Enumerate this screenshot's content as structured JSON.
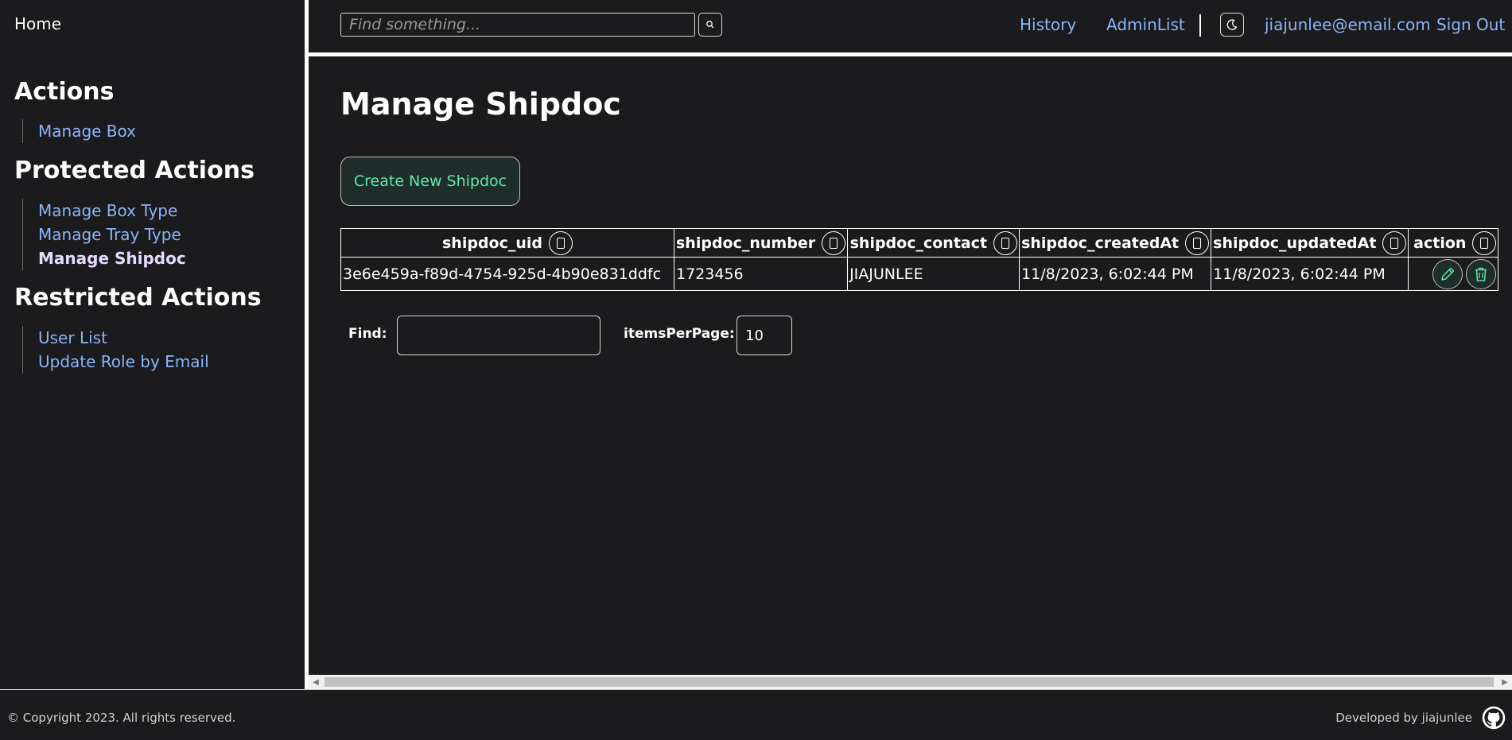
{
  "sidebar": {
    "home": "Home",
    "sections": [
      {
        "title": "Actions",
        "items": [
          {
            "label": "Manage Box",
            "active": false
          }
        ]
      },
      {
        "title": "Protected Actions",
        "items": [
          {
            "label": "Manage Box Type",
            "active": false
          },
          {
            "label": "Manage Tray Type",
            "active": false
          },
          {
            "label": "Manage Shipdoc",
            "active": true
          }
        ]
      },
      {
        "title": "Restricted Actions",
        "items": [
          {
            "label": "User List",
            "active": false
          },
          {
            "label": "Update Role by Email",
            "active": false
          }
        ]
      }
    ]
  },
  "topbar": {
    "search_placeholder": "Find something...",
    "search_icon": "search-icon",
    "links": {
      "history": "History",
      "adminlist": "AdminList",
      "email": "jiajunlee@email.com",
      "signout": "Sign Out"
    },
    "theme_icon": "moon-icon"
  },
  "main": {
    "title": "Manage Shipdoc",
    "create_button": "Create New Shipdoc",
    "table": {
      "headers": {
        "uid": "shipdoc_uid",
        "number": "shipdoc_number",
        "contact": "shipdoc_contact",
        "created": "shipdoc_createdAt",
        "updated": "shipdoc_updatedAt",
        "action": "action"
      },
      "rows": [
        {
          "uid": "3e6e459a-f89d-4754-925d-4b90e831ddfc",
          "number": "1723456",
          "contact": "JIAJUNLEE",
          "created": "11/8/2023, 6:02:44 PM",
          "updated": "11/8/2023, 6:02:44 PM"
        }
      ]
    },
    "filters": {
      "find_label": "Find:",
      "find_value": "",
      "per_page_label": "itemsPerPage:",
      "per_page_value": "10"
    }
  },
  "footer": {
    "copyright": "© Copyright 2023. All rights reserved.",
    "developed_by": "Developed by jiajunlee",
    "github_icon": "github-icon"
  },
  "colors": {
    "background": "#1b1b1d",
    "link": "#8ab4f8",
    "active_link": "#e6dbff",
    "accent_green": "#5ee8a9"
  }
}
